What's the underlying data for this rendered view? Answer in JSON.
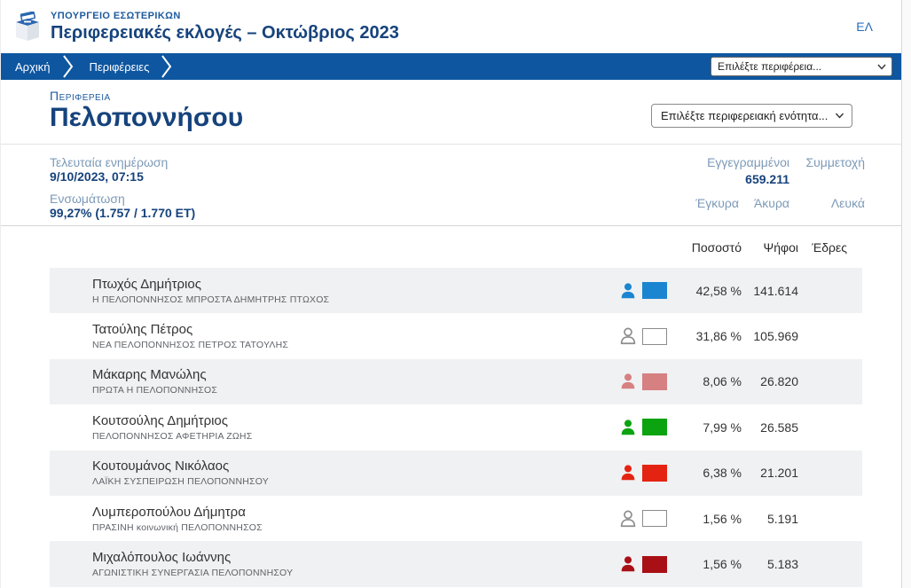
{
  "header": {
    "ministry": "ΥΠΟΥΡΓΕΙΟ ΕΣΩΤΕΡΙΚΩΝ",
    "title": "Περιφερειακές εκλογές – Οκτώβριος 2023",
    "language": "ΕΛ"
  },
  "breadcrumb": {
    "items": [
      {
        "label": "Αρχική"
      },
      {
        "label": "Περιφέρειες"
      }
    ],
    "region_select_placeholder": "Επιλέξτε περιφέρεια..."
  },
  "region": {
    "label": "Περιφέρεια",
    "name": "Πελοποννήσου",
    "unit_select_placeholder": "Επιλέξτε περιφερειακή ενότητα..."
  },
  "stats": {
    "last_update_label": "Τελευταία ενημέρωση",
    "last_update_value": "9/10/2023, 07:15",
    "integration_label": "Ενσωμάτωση",
    "integration_value": "99,27% (1.757 / 1.770 ΕΤ)",
    "registered_label": "Εγγεγραμμένοι",
    "registered_value": "659.211",
    "participation_label": "Συμμετοχή",
    "valid_label": "Έγκυρα",
    "invalid_label": "Άκυρα",
    "blank_label": "Λευκά"
  },
  "results": {
    "headers": {
      "percent": "Ποσοστό",
      "votes": "Ψήφοι",
      "seats": "Έδρες"
    },
    "rows": [
      {
        "candidate": "Πτωχός Δημήτριος",
        "party": "Η ΠΕΛΟΠΟΝΝΗΣΟΣ ΜΠΡΟΣΤΑ ΔΗΜΗΤΡΗΣ ΠΤΩΧΟΣ",
        "swatch_style": "filled",
        "color": "#1b85d1",
        "percent": "42,58 %",
        "votes": "141.614",
        "seats": ""
      },
      {
        "candidate": "Τατούλης Πέτρος",
        "party": "ΝΕΑ ΠΕΛΟΠΟΝΝΗΣΟΣ ΠΕΤΡΟΣ ΤΑΤΟΥΛΗΣ",
        "swatch_style": "outline",
        "color": "#8c8c8c",
        "percent": "31,86 %",
        "votes": "105.969",
        "seats": ""
      },
      {
        "candidate": "Μάκαρης Μανώλης",
        "party": "ΠΡΩΤΑ Η ΠΕΛΟΠΟΝΝΗΣΟΣ",
        "swatch_style": "filled",
        "color": "#d68082",
        "percent": "8,06 %",
        "votes": "26.820",
        "seats": ""
      },
      {
        "candidate": "Κουτσούλης Δημήτριος",
        "party": "ΠΕΛΟΠΟΝΝΗΣΟΣ ΑΦΕΤΗΡΙΑ ΖΩΗΣ",
        "swatch_style": "filled",
        "color": "#0ca311",
        "percent": "7,99 %",
        "votes": "26.585",
        "seats": ""
      },
      {
        "candidate": "Κουτουμάνος Νικόλαος",
        "party": "ΛΑΪΚΗ ΣΥΣΠΕΙΡΩΣΗ ΠΕΛΟΠΟΝΝΗΣΟΥ",
        "swatch_style": "filled",
        "color": "#e42313",
        "percent": "6,38 %",
        "votes": "21.201",
        "seats": ""
      },
      {
        "candidate": "Λυμπεροπούλου Δήμητρα",
        "party": "ΠΡΑΣΙΝΗ κοινωνική ΠΕΛΟΠΟΝΝΗΣΟΣ",
        "swatch_style": "outline",
        "color": "#8c8c8c",
        "percent": "1,56 %",
        "votes": "5.191",
        "seats": ""
      },
      {
        "candidate": "Μιχαλόπουλος Ιωάννης",
        "party": "ΑΓΩΝΙΣΤΙΚΗ ΣΥΝΕΡΓΑΣΙΑ ΠΕΛΟΠΟΝΝΗΣΟΥ",
        "swatch_style": "filled",
        "color": "#a91016",
        "percent": "1,56 %",
        "votes": "5.183",
        "seats": ""
      }
    ]
  },
  "colors": {
    "breadcrumb_bg": "#0e56a0",
    "title_blue": "#16437c",
    "accent_blue": "#1d5a9e",
    "row_alt_bg": "#f0f1f2"
  }
}
